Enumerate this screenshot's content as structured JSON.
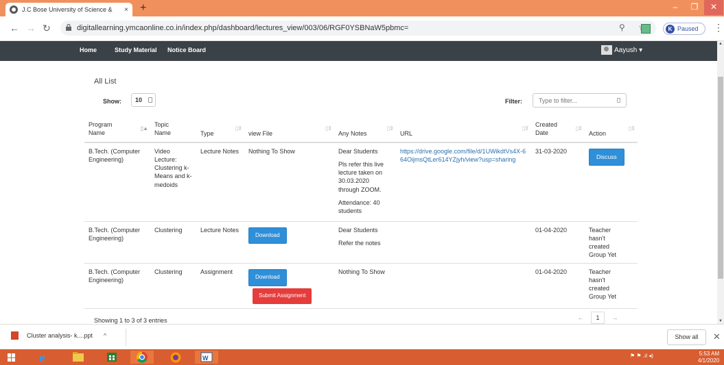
{
  "browser": {
    "tab_title": "J.C Bose University of Science &",
    "tab_close": "×",
    "new_tab": "+",
    "url": "digitallearning.ymcaonline.co.in/index.php/dashboard/lectures_view/003/06/RGF0YSBNaW5pbmc=",
    "profile_initial": "K",
    "profile_status": "Paused",
    "win_min": "–",
    "win_max": "❐",
    "win_close": "✕"
  },
  "navbar": {
    "home": "Home",
    "study_material": "Study Material",
    "notice_board": "Notice Board",
    "user": "Aayush ▾"
  },
  "list": {
    "heading": "All List",
    "show_label": "Show:",
    "show_value": "10",
    "filter_label": "Filter:",
    "filter_placeholder": "Type to filter..."
  },
  "table": {
    "headers": {
      "program": "Program Name",
      "topic": "Topic Name",
      "type": "Type",
      "view_file": "view File",
      "notes": "Any Notes",
      "url": "URL",
      "created": "Created Date",
      "action": "Action"
    },
    "rows": [
      {
        "program": "B.Tech. (Computer Engineering)",
        "topic": "Video Lecture: Clustering k-Means and k-medoids",
        "type": "Lecture Notes",
        "view_file": "Nothing To Show",
        "notes": [
          "Dear Students",
          "Pls refer this live lecture taken on 30.03.2020 through ZOOM.",
          "Attendance: 40 students"
        ],
        "url": "https://drive.google.com/file/d/1UWikdtVs4X-664OijmsQtLer614YZjyh/view?usp=sharing",
        "created": "31-03-2020",
        "action": "Discuss"
      },
      {
        "program": "B.Tech. (Computer Engineering)",
        "topic": "Clustering",
        "type": "Lecture Notes",
        "view_file": "Download",
        "notes": [
          "Dear Students",
          "Refer the notes"
        ],
        "url": "",
        "created": "01-04-2020",
        "action": "Teacher hasn't created Group Yet"
      },
      {
        "program": "B.Tech. (Computer Engineering)",
        "topic": "Clustering",
        "type": "Assignment",
        "view_file": "Download",
        "submit": "Submit Assignment",
        "notes": [
          "Nothing To Show"
        ],
        "url": "",
        "created": "01-04-2020",
        "action": "Teacher hasn't created Group Yet"
      }
    ]
  },
  "footer": {
    "showing": "Showing 1 to 3 of 3 entries",
    "prev": "←",
    "page": "1",
    "next": "→"
  },
  "downloads": {
    "file": "Cluster analysis- k....ppt",
    "caret": "^",
    "show_all": "Show all",
    "close": "✕"
  },
  "taskbar": {
    "time": "5:53 AM",
    "date": "4/1/2020"
  },
  "colors": {
    "tab_strip": "#f0915d",
    "navbar": "#3a4147",
    "link": "#2a6fb0",
    "button_blue": "#2f8fd8",
    "button_red": "#e53c3c",
    "taskbar": "#d85d30"
  }
}
